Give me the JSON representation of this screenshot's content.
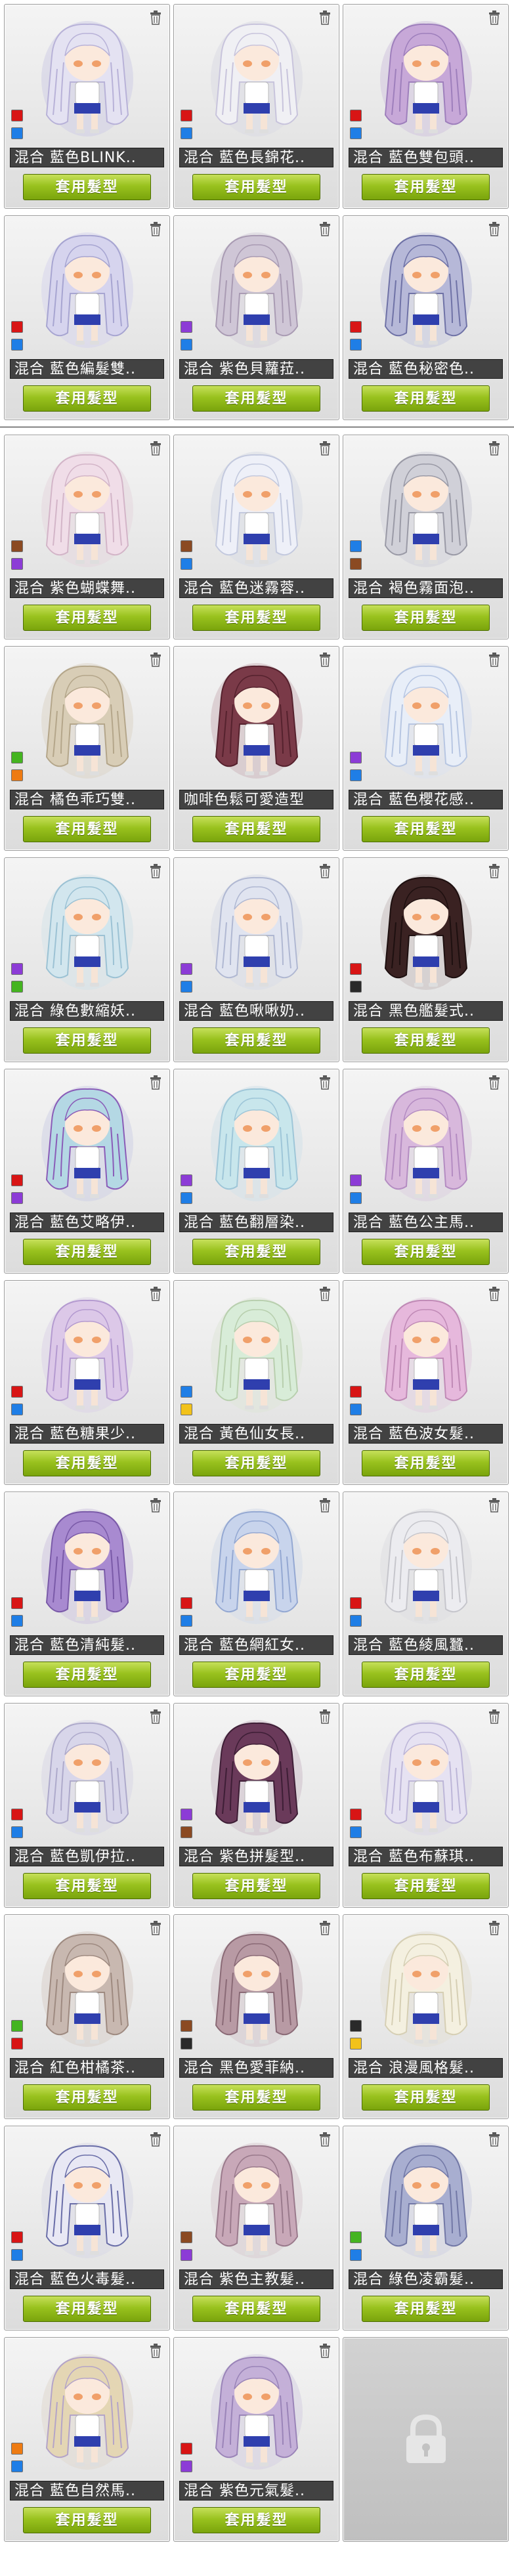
{
  "apply_label": "套用髮型",
  "swatch_colors": {
    "red": "#d81515",
    "blue": "#1f7ee6",
    "purple": "#8c3cd6",
    "brown": "#8b4a22",
    "green": "#44b420",
    "yellow": "#f2c21a",
    "orange": "#ee7b12",
    "black": "#2a2a2a"
  },
  "panel1": {
    "cards": [
      {
        "name": "混合 藍色BLINK..",
        "swatches": [
          "red",
          "blue"
        ],
        "hair": "#e4e2f2",
        "shade": "#b8b2d8",
        "bg": "#cfcde6"
      },
      {
        "name": "混合 藍色長錦花..",
        "swatches": [
          "red",
          "blue"
        ],
        "hair": "#f0f0f4",
        "shade": "#c8c4dc",
        "bg": "#dadbe4"
      },
      {
        "name": "混合 藍色雙包頭..",
        "swatches": [
          "red",
          "blue"
        ],
        "hair": "#c7a8d8",
        "shade": "#9e7fbc",
        "bg": "#d2c4df"
      },
      {
        "name": "混合 藍色編髮雙..",
        "swatches": [
          "red",
          "blue"
        ],
        "hair": "#d6d4ee",
        "shade": "#a7a5d1",
        "bg": "#d7d5ec"
      },
      {
        "name": "混合 紫色貝蘿菈..",
        "swatches": [
          "purple",
          "blue"
        ],
        "hair": "#cfc6d6",
        "shade": "#a99bb3",
        "bg": "#d6cfda"
      },
      {
        "name": "混合 藍色秘密色..",
        "swatches": [
          "red",
          "blue"
        ],
        "hair": "#b6b8d8",
        "shade": "#6f72a6",
        "bg": "#c7c8de"
      }
    ]
  },
  "panel2": {
    "cards": [
      {
        "name": "混合 紫色蝴蝶舞..",
        "swatches": [
          "brown",
          "purple"
        ],
        "hair": "#f0dde8",
        "shade": "#d3b5c8",
        "bg": "#e6d7df",
        "locked": false
      },
      {
        "name": "混合 藍色迷霧蓉..",
        "swatches": [
          "brown",
          "blue"
        ],
        "hair": "#eef0f8",
        "shade": "#c3c9de",
        "bg": "#d9dce6",
        "locked": false
      },
      {
        "name": "混合 褐色霧面泡..",
        "swatches": [
          "blue",
          "brown"
        ],
        "hair": "#d0d0d8",
        "shade": "#9a9aa6",
        "bg": "#d2d2da",
        "locked": false
      },
      {
        "name": "混合 橘色乖巧雙..",
        "swatches": [
          "green",
          "orange"
        ],
        "hair": "#d8cdb6",
        "shade": "#b4a68a",
        "bg": "#ddd6c8",
        "locked": false
      },
      {
        "name": "咖啡色鬆可愛造型",
        "swatches": [],
        "hair": "#7a3a48",
        "shade": "#56222e",
        "bg": "#cdb8be",
        "locked": false
      },
      {
        "name": "混合 藍色櫻花感..",
        "swatches": [
          "purple",
          "blue"
        ],
        "hair": "#e8eef8",
        "shade": "#b7c6e2",
        "bg": "#dde2ee",
        "locked": false
      },
      {
        "name": "混合 綠色數縮妖..",
        "swatches": [
          "purple",
          "green"
        ],
        "hair": "#d2e6ee",
        "shade": "#9cc2d4",
        "bg": "#d6e4ea",
        "locked": false
      },
      {
        "name": "混合 藍色啾啾奶..",
        "swatches": [
          "purple",
          "blue"
        ],
        "hair": "#e0e4f0",
        "shade": "#b0b8d2",
        "bg": "#d9dde8",
        "locked": false
      },
      {
        "name": "混合 黑色艦髮式..",
        "swatches": [
          "red",
          "black"
        ],
        "hair": "#3a2222",
        "shade": "#1e1010",
        "bg": "#c8bfbf",
        "locked": false
      },
      {
        "name": "混合 藍色艾略伊..",
        "swatches": [
          "red",
          "purple"
        ],
        "hair": "#b4d8e4",
        "shade": "#8a5cb8",
        "bg": "#cfd2e6",
        "locked": false
      },
      {
        "name": "混合 藍色翻層染..",
        "swatches": [
          "purple",
          "blue"
        ],
        "hair": "#c8e6ec",
        "shade": "#9ec6d8",
        "bg": "#d4e2ea",
        "locked": false
      },
      {
        "name": "混合 藍色公主馬..",
        "swatches": [
          "purple",
          "blue"
        ],
        "hair": "#d8b8dc",
        "shade": "#b48cc2",
        "bg": "#dccfe0",
        "locked": false
      },
      {
        "name": "混合 藍色糖果少..",
        "swatches": [
          "red",
          "blue"
        ],
        "hair": "#dcc8e8",
        "shade": "#b49ad0",
        "bg": "#ddd3e8",
        "locked": false
      },
      {
        "name": "混合 黃色仙女長..",
        "swatches": [
          "blue",
          "yellow"
        ],
        "hair": "#d8ecd8",
        "shade": "#b8cfae",
        "bg": "#dfe6d8",
        "locked": false
      },
      {
        "name": "混合 藍色波女髮..",
        "swatches": [
          "red",
          "blue"
        ],
        "hair": "#e6b8dc",
        "shade": "#c08ab6",
        "bg": "#e2cfe0",
        "locked": false
      },
      {
        "name": "混合 藍色清純髮..",
        "swatches": [
          "red",
          "blue"
        ],
        "hair": "#a88ad0",
        "shade": "#7a5aa8",
        "bg": "#cfc6e0",
        "locked": false
      },
      {
        "name": "混合 藍色網紅女..",
        "swatches": [
          "red",
          "blue"
        ],
        "hair": "#c8d4ec",
        "shade": "#94a8d2",
        "bg": "#d6dcea",
        "locked": false
      },
      {
        "name": "混合 藍色綾風蠶..",
        "swatches": [
          "red",
          "blue"
        ],
        "hair": "#ececf0",
        "shade": "#c6c6cc",
        "bg": "#dedee2",
        "locked": false
      },
      {
        "name": "混合 藍色凱伊拉..",
        "swatches": [
          "red",
          "blue"
        ],
        "hair": "#d8d6ea",
        "shade": "#aeaacb",
        "bg": "#d8d7e6",
        "locked": false
      },
      {
        "name": "混合 紫色拼髮型..",
        "swatches": [
          "purple",
          "brown"
        ],
        "hair": "#6a3a5a",
        "shade": "#3e1e36",
        "bg": "#cdbfcb",
        "locked": false
      },
      {
        "name": "混合 藍色布蘇琪..",
        "swatches": [
          "red",
          "blue"
        ],
        "hair": "#e6e2f2",
        "shade": "#bdb6d8",
        "bg": "#dcd9e8",
        "locked": false
      },
      {
        "name": "混合 紅色柑橘茶..",
        "swatches": [
          "green",
          "red"
        ],
        "hair": "#c8b8b0",
        "shade": "#9e8a80",
        "bg": "#d8cfca",
        "locked": false
      },
      {
        "name": "混合 黑色愛菲納..",
        "swatches": [
          "brown",
          "black"
        ],
        "hair": "#b89aa4",
        "shade": "#8a6a76",
        "bg": "#d4c6cc",
        "locked": false
      },
      {
        "name": "混合 浪漫風格髮..",
        "swatches": [
          "black",
          "yellow"
        ],
        "hair": "#f4f0e0",
        "shade": "#d6cfb4",
        "bg": "#e4e0d6",
        "locked": false
      },
      {
        "name": "混合 藍色火毒髮..",
        "swatches": [
          "red",
          "blue"
        ],
        "hair": "#e8e8f4",
        "shade": "#6a6ea8",
        "bg": "#d8d8e6",
        "locked": false
      },
      {
        "name": "混合 紫色主教髮..",
        "swatches": [
          "brown",
          "purple"
        ],
        "hair": "#c8a8b8",
        "shade": "#9a7a8c",
        "bg": "#d8ccd2",
        "locked": false
      },
      {
        "name": "混合 綠色凌霸髮..",
        "swatches": [
          "green",
          "blue"
        ],
        "hair": "#a8aed0",
        "shade": "#7278a6",
        "bg": "#cfd1e2",
        "locked": false
      },
      {
        "name": "混合 藍色自然馬..",
        "swatches": [
          "orange",
          "blue"
        ],
        "hair": "#e4d6b4",
        "shade": "#b4a4c8",
        "bg": "#e0d9d0",
        "locked": false
      },
      {
        "name": "混合 紫色元氣髮..",
        "swatches": [
          "red",
          "purple"
        ],
        "hair": "#c4b0d8",
        "shade": "#9a84b8",
        "bg": "#d6cfe2",
        "locked": false
      },
      {
        "name": "",
        "swatches": [],
        "hair": "",
        "shade": "",
        "bg": "",
        "locked": true
      }
    ]
  }
}
